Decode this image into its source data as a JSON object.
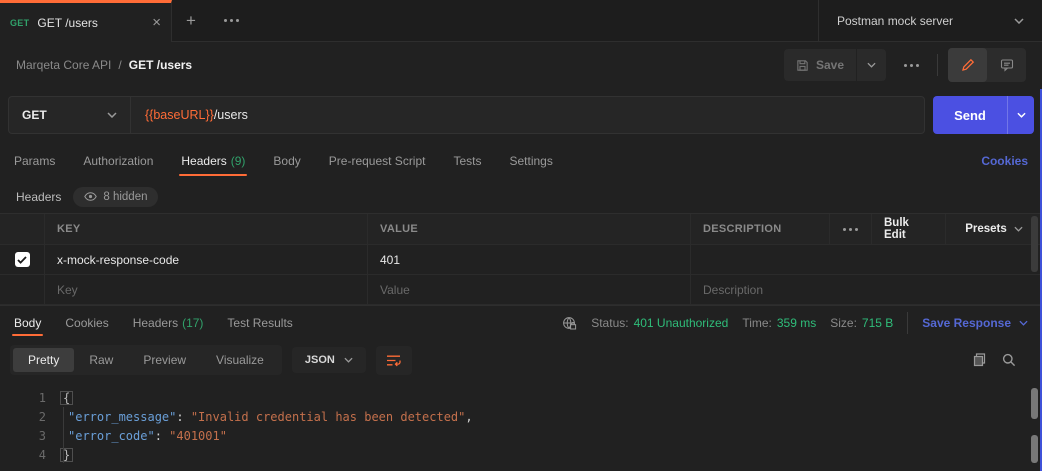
{
  "colors": {
    "accent_orange": "#ff6c37",
    "send_blue": "#4b50e2",
    "link_blue": "#5568d4",
    "status_green": "#2fbd7a",
    "method_green": "#31a26b"
  },
  "tabbar": {
    "tab_method": "GET",
    "tab_title": "GET /users",
    "close": "×",
    "new_tab": "+",
    "env_selector": "Postman mock server"
  },
  "breadcrumb": {
    "collection": "Marqeta Core API",
    "separator": "/",
    "request": "GET /users"
  },
  "toolbar": {
    "save_label": "Save"
  },
  "request": {
    "method": "GET",
    "url_var": "{{baseURL}}",
    "url_path": "/users",
    "send_label": "Send"
  },
  "request_tabs": {
    "params": "Params",
    "authorization": "Authorization",
    "headers": "Headers",
    "headers_count": "(9)",
    "body": "Body",
    "prerequest": "Pre-request Script",
    "tests": "Tests",
    "settings": "Settings",
    "cookies_link": "Cookies"
  },
  "headers_editor": {
    "title": "Headers",
    "hidden_badge": "8 hidden",
    "col_key": "KEY",
    "col_value": "VALUE",
    "col_description": "DESCRIPTION",
    "bulk_edit": "Bulk Edit",
    "presets": "Presets",
    "row1": {
      "key": "x-mock-response-code",
      "value": "401",
      "description": ""
    },
    "placeholder": {
      "key": "Key",
      "value": "Value",
      "description": "Description"
    }
  },
  "response": {
    "tab_body": "Body",
    "tab_cookies": "Cookies",
    "tab_headers": "Headers",
    "tab_headers_count": "(17)",
    "tab_tests": "Test Results",
    "status_label": "Status:",
    "status_value": "401 Unauthorized",
    "time_label": "Time:",
    "time_value": "359 ms",
    "size_label": "Size:",
    "size_value": "715 B",
    "save_response": "Save Response",
    "view_pretty": "Pretty",
    "view_raw": "Raw",
    "view_preview": "Preview",
    "view_visualize": "Visualize",
    "format": "JSON"
  },
  "code": {
    "ln1": "1",
    "ln2": "2",
    "ln3": "3",
    "ln4": "4",
    "open_brace": "{",
    "l2_key": "\"error_message\"",
    "l2_sep": ": ",
    "l2_str": "\"Invalid credential has been detected\"",
    "l2_comma": ",",
    "l3_key": "\"error_code\"",
    "l3_sep": ": ",
    "l3_str": "\"401001\"",
    "close_brace": "}"
  }
}
